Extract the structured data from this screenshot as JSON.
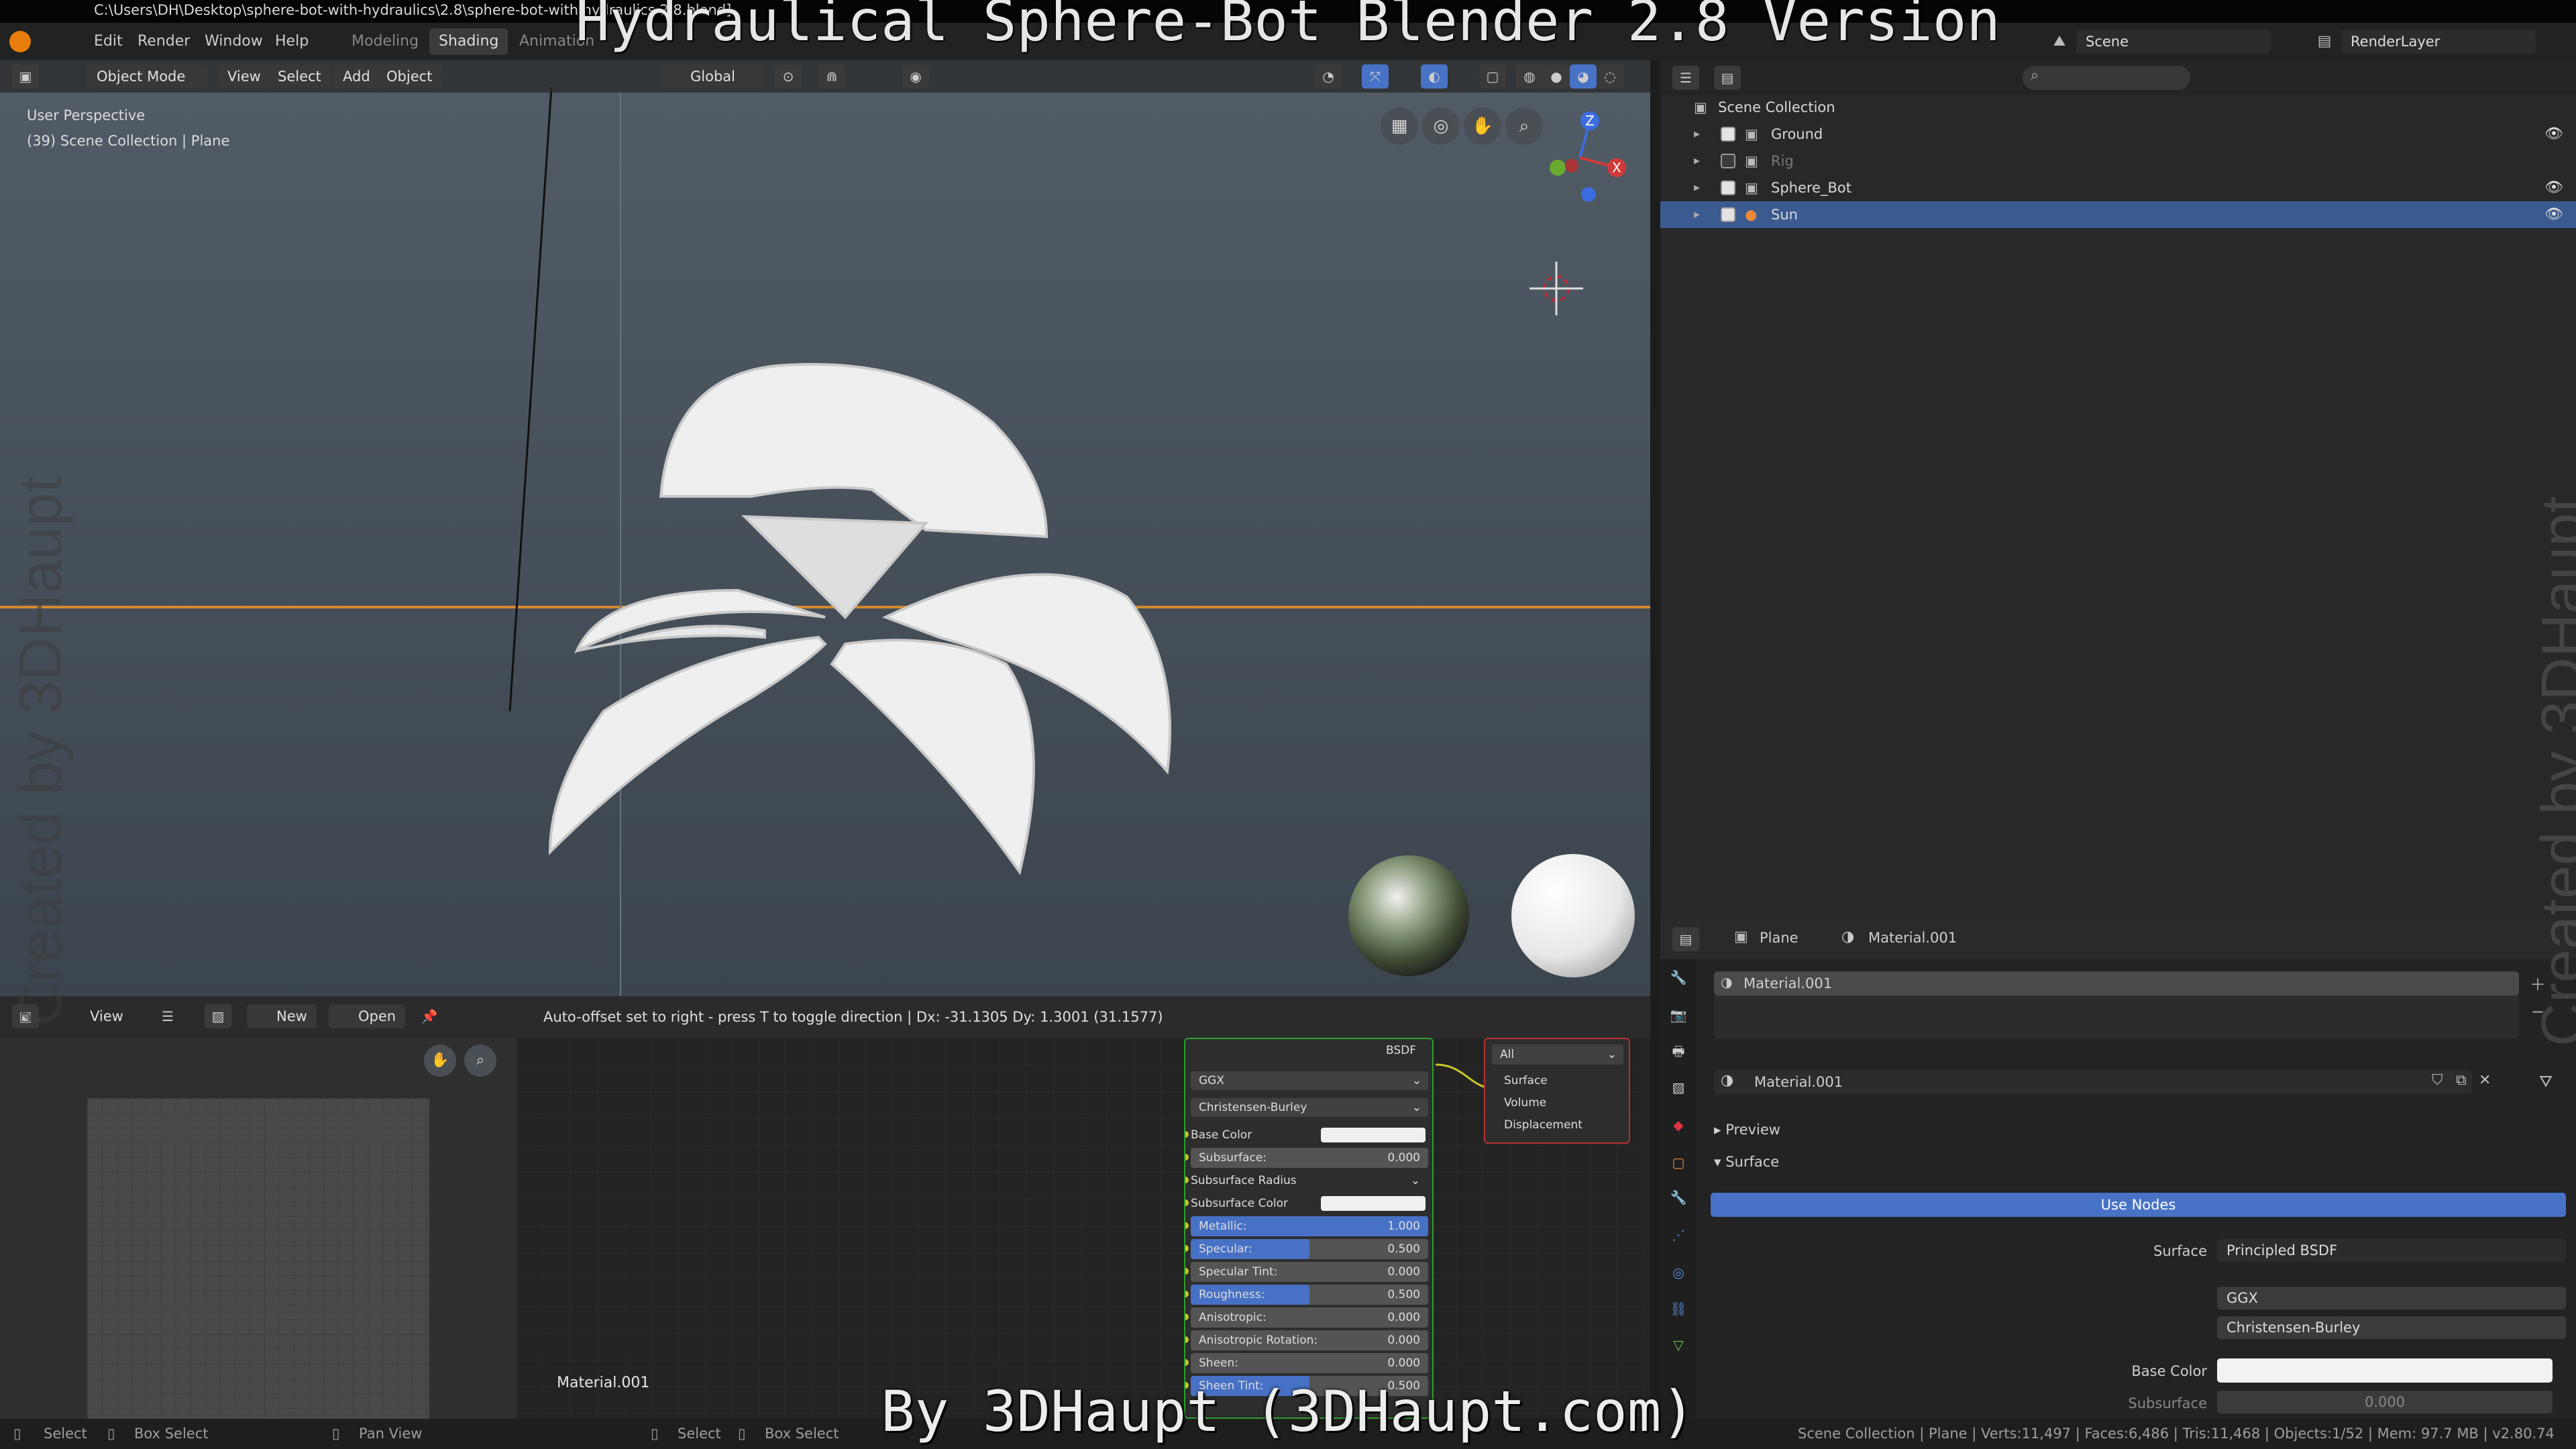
{
  "window": {
    "path": "C:\\Users\\DH\\Desktop\\sphere-bot-with-hydraulics\\2.8\\sphere-bot-with hydraulics 2.8.blend]"
  },
  "overlay": {
    "title": "Hydraulical Sphere-Bot Blender 2.8 Version",
    "credit": "By 3DHaupt (3DHaupt.com)",
    "watermark": "Created by 3DHaupt"
  },
  "menu": {
    "items": [
      "Edit",
      "Render",
      "Window",
      "Help"
    ],
    "workspaces": [
      "Modeling",
      "Shading",
      "Animation"
    ],
    "active_workspace": "Shading",
    "scene": "Scene",
    "view_layer": "RenderLayer"
  },
  "viewport": {
    "mode": "Object Mode",
    "menus": [
      "View",
      "Select",
      "Add",
      "Object"
    ],
    "orientation": "Global",
    "perspective": "User Perspective",
    "collection_info": "(39) Scene Collection | Plane",
    "axes": {
      "z": "Z",
      "x": "X",
      "y": "Y"
    }
  },
  "outliner": {
    "root": "Scene Collection",
    "items": [
      {
        "name": "Ground",
        "checked": true,
        "visible": true
      },
      {
        "name": "Rig",
        "checked": false,
        "visible": false
      },
      {
        "name": "Sphere_Bot",
        "checked": true,
        "visible": true
      },
      {
        "name": "Sun",
        "checked": true,
        "visible": true,
        "selected": true
      }
    ]
  },
  "node_editor": {
    "view": "View",
    "new": "New",
    "open": "Open",
    "status_message": "Auto-offset set to right - press T to toggle direction  |  Dx: -31.1305   Dy: 1.3001 (31.1577)",
    "material_label": "Material.001",
    "bsdf": {
      "title": "BSDF",
      "distribution": "GGX",
      "subsurface_method": "Christensen-Burley",
      "rows": [
        {
          "label": "Base Color",
          "kind": "color",
          "color": "#f0f0f0"
        },
        {
          "label": "Subsurface:",
          "value": "0.000",
          "fill": 0
        },
        {
          "label": "Subsurface Radius",
          "kind": "dropdown"
        },
        {
          "label": "Subsurface Color",
          "kind": "color",
          "color": "#f0f0f0"
        },
        {
          "label": "Metallic:",
          "value": "1.000",
          "fill": 1.0
        },
        {
          "label": "Specular:",
          "value": "0.500",
          "fill": 0.5
        },
        {
          "label": "Specular Tint:",
          "value": "0.000",
          "fill": 0
        },
        {
          "label": "Roughness:",
          "value": "0.500",
          "fill": 0.5
        },
        {
          "label": "Anisotropic:",
          "value": "0.000",
          "fill": 0
        },
        {
          "label": "Anisotropic Rotation:",
          "value": "0.000",
          "fill": 0
        },
        {
          "label": "Sheen:",
          "value": "0.000",
          "fill": 0
        },
        {
          "label": "Sheen Tint:",
          "value": "0.500",
          "fill": 0.5
        }
      ]
    },
    "output": {
      "target": "All",
      "sockets": [
        "Surface",
        "Volume",
        "Displacement"
      ]
    }
  },
  "properties": {
    "object": "Plane",
    "material": "Material.001",
    "slot": "Material.001",
    "datablock": "Material.001",
    "panels": {
      "preview": "Preview",
      "surface": "Surface"
    },
    "use_nodes": "Use Nodes",
    "surface_label": "Surface",
    "surface_value": "Principled BSDF",
    "distribution": "GGX",
    "subsurface_method": "Christensen-Burley",
    "base_color_label": "Base Color",
    "subsurface_label": "Subsurface",
    "subsurface_value": "0.000"
  },
  "statusbar": {
    "items": [
      "Select",
      "Box Select",
      "Pan View",
      "Select",
      "Box Select"
    ],
    "stats": "Scene Collection | Plane | Verts:11,497 | Faces:6,486 | Tris:11,468 | Objects:1/52 | Mem: 97.7 MB | v2.80.74"
  },
  "colors": {
    "accent": "#4772c6",
    "selection": "#3b5a8f",
    "bsdf_border": "#2ca02c",
    "output_border": "#b73131",
    "horizon": "#d38a30"
  }
}
